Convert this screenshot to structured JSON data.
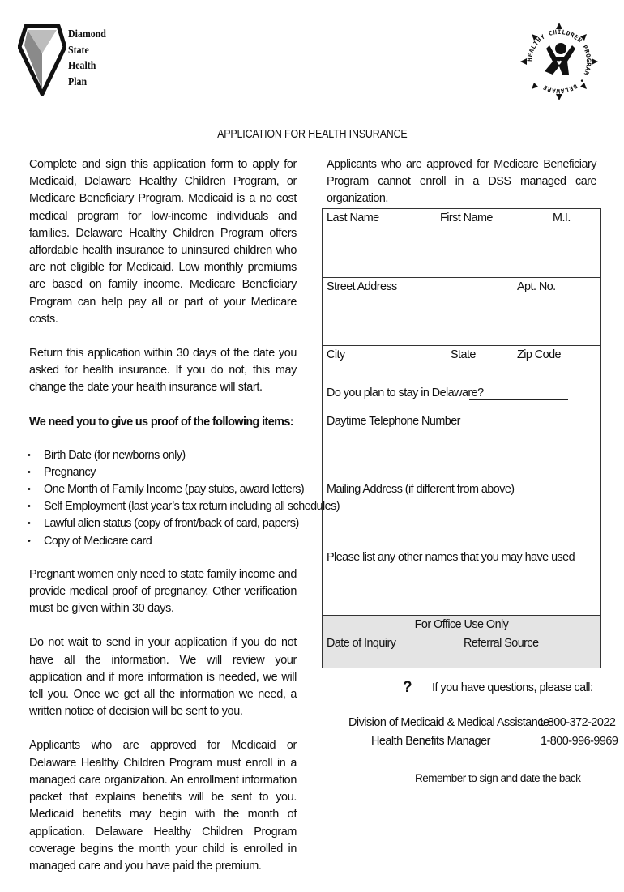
{
  "header": {
    "logo_left_lines": [
      "Diamond",
      "State",
      "Health",
      "Plan"
    ],
    "logo_right_ring_text": "HEALTHY CHILDREN PROGRAM • DELAWARE",
    "title": "APPLICATION FOR HEALTH INSURANCE"
  },
  "left_column": {
    "intro": "Complete and sign this application form to apply for Medicaid, Delaware Healthy Children Program, or Medicare Beneficiary Program.  Medicaid is a no cost medical program for low-income individuals and families. Delaware Healthy Children Program offers affordable health insurance to uninsured children who are not eligible for Medicaid.  Low monthly premiums are based on family income. Medicare Beneficiary Program can help pay all or part of your Medicare costs.",
    "return_notice": "Return this application within 30 days of the date you asked for health insurance.  If you do not, this may change the date your health insurance will start.",
    "proof_heading": "We need you to give us proof of the following items:",
    "proof_items": [
      "Birth Date (for newborns only)",
      "Pregnancy",
      "One Month of Family Income (pay stubs, award letters)",
      "Self Employment (last year’s tax return including all schedules)",
      "Lawful alien status (copy of front/back of card, papers)",
      "Copy of Medicare card"
    ],
    "bullet_char": "•",
    "pregnant_notice": "Pregnant women only need to state family income and provide medical proof of pregnancy.  Other verification must be given within 30 days.",
    "do_not_wait": "Do not wait to send in your application if you do not have all the information.  We will review your application and if more information is needed, we will tell you.  Once we get all the information we need, a written notice of decision will be sent to you.",
    "enrollment_notice": "Applicants who are approved for Medicaid or Delaware Healthy Children Program must enroll in a managed care organization.  An enrollment information packet that explains benefits will be sent to you.  Medicaid benefits may begin with the month of application. Delaware Healthy Children Program coverage begins the month your child is enrolled in managed care and you have paid the premium."
  },
  "right_column": {
    "mbp_notice": "Applicants who are approved for Medicare Beneficiary Program cannot enroll in a DSS managed care organization.",
    "form": {
      "last_name": "Last Name",
      "first_name": "First Name",
      "mi": "M.I.",
      "street_address": "Street Address",
      "apt_no": "Apt. No.",
      "city": "City",
      "state": "State",
      "zip_code": "Zip Code",
      "stay_in_delaware": "Do you plan to stay in Delaware?",
      "daytime_phone": "Daytime Telephone Number",
      "mailing_address": "Mailing Address (if different from above)",
      "other_names": "Please list any other names that you may have used",
      "office_use_title": "For Office Use Only",
      "date_of_inquiry": "Date of Inquiry",
      "referral_source": "Referral Source"
    },
    "help": {
      "question_mark": "?",
      "prompt": "If you have questions, please call:",
      "contacts": [
        {
          "name": "Division of Medicaid & Medical Assistance",
          "phone": "1-800-372-2022"
        },
        {
          "name": "Health Benefits Manager",
          "phone": "1-800-996-9969"
        }
      ],
      "reminder": "Remember to sign and date the back"
    }
  }
}
